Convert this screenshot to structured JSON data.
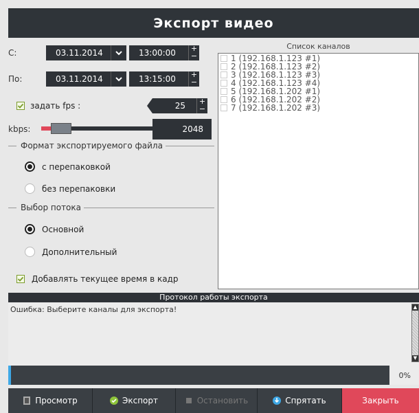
{
  "window": {
    "title": "Экспорт видео"
  },
  "from": {
    "label": "С:",
    "date": "03.11.2014",
    "time": "13:00:00"
  },
  "to": {
    "label": "По:",
    "date": "03.11.2014",
    "time": "13:15:00"
  },
  "fps": {
    "label": "задать fps :",
    "checked": true,
    "value": "25"
  },
  "kbps": {
    "label": "kbps:",
    "value": "2048",
    "slider_fraction": 0.12
  },
  "format_group": {
    "title": "Формат экспортируемого файла",
    "options": [
      {
        "label": "с перепаковкой",
        "selected": true
      },
      {
        "label": "без перепаковки",
        "selected": false
      }
    ]
  },
  "stream_group": {
    "title": "Выбор потока",
    "options": [
      {
        "label": "Основной",
        "selected": true
      },
      {
        "label": "Дополнительный",
        "selected": false
      }
    ]
  },
  "timestamp": {
    "label": "Добавлять текущее время в кадр",
    "checked": true
  },
  "channels": {
    "title": "Список каналов",
    "items": [
      "1 (192.168.1.123 #1)",
      "2 (192.168.1.123 #2)",
      "3 (192.168.1.123 #3)",
      "4 (192.168.1.123 #4)",
      "5 (192.168.1.202 #1)",
      "6 (192.168.1.202 #2)",
      "7 (192.168.1.202 #3)"
    ]
  },
  "log": {
    "title": "Протокол работы экспорта",
    "message": "Ошибка: Выберите каналы для экспорта!"
  },
  "progress": {
    "value": 0,
    "text": "0%"
  },
  "buttons": {
    "preview": "Просмотр",
    "export": "Экспорт",
    "stop": "Остановить",
    "hide": "Спрятать",
    "close": "Закрыть"
  },
  "colors": {
    "accent": "#3ea8e6",
    "danger": "#e0485a",
    "dark": "#2e3237",
    "check": "#7a9a2a"
  }
}
